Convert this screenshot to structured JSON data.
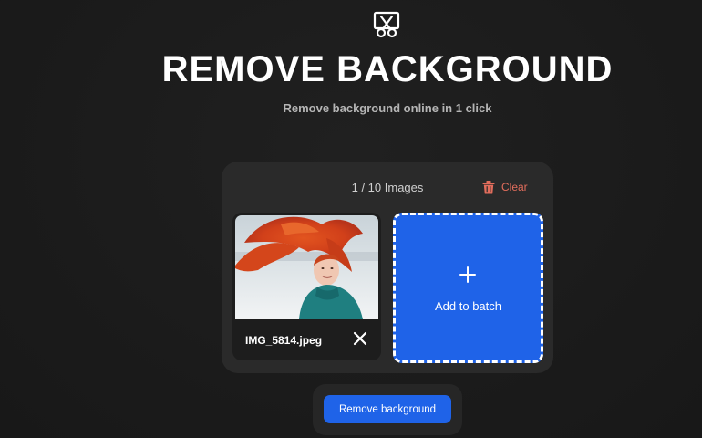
{
  "header": {
    "logo_icon": "scissors-frame-icon",
    "title": "REMOVE BACKGROUND",
    "subtitle": "Remove background online in 1 click"
  },
  "batch": {
    "count_label": "1 / 10 Images",
    "clear_label": "Clear",
    "clear_icon": "trash-icon",
    "files": [
      {
        "name": "IMG_5814.jpeg",
        "remove_icon": "close-icon"
      }
    ],
    "add_label": "Add to batch",
    "add_icon": "plus-icon"
  },
  "actions": {
    "primary_label": "Remove background"
  },
  "colors": {
    "background": "#1c1c1c",
    "panel": "#2a2a2a",
    "accent": "#1f63e8",
    "danger": "#e26d5c"
  }
}
